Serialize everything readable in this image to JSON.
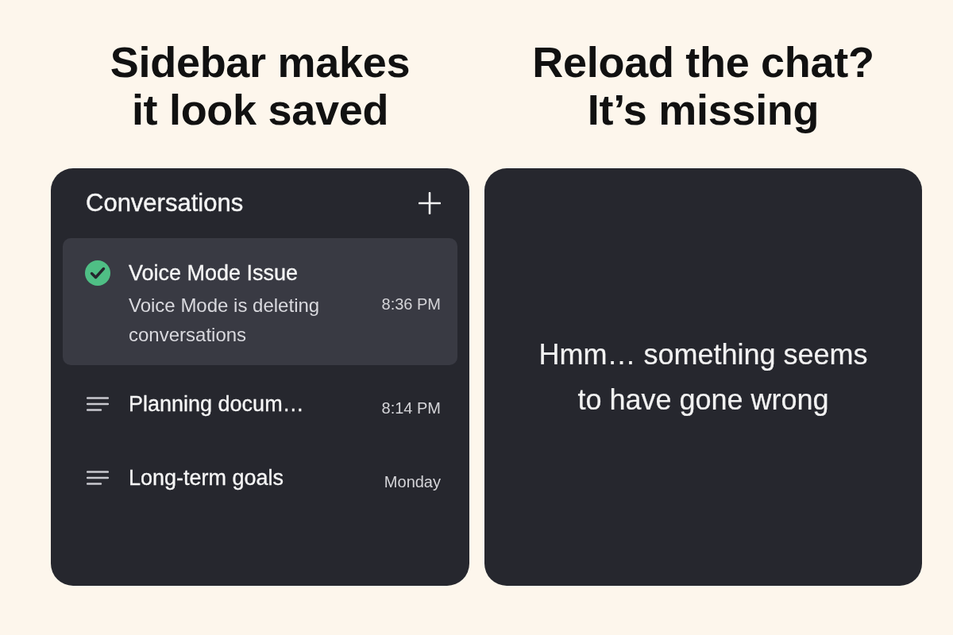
{
  "panels": [
    {
      "kind": "sidebar",
      "caption": "Sidebar makes\nit look saved",
      "header": {
        "title": "Conversations"
      },
      "conversations": [
        {
          "title": "Voice Mode Issue",
          "snippet": "Voice Mode is deleting conversations",
          "time": "8:36 PM",
          "selected": true,
          "checked": true
        },
        {
          "title": "Planning docum…",
          "time": "8:14 PM",
          "selected": false,
          "checked": false
        },
        {
          "title": "Long-term goals",
          "time": "Monday",
          "selected": false,
          "checked": false
        }
      ]
    },
    {
      "kind": "error",
      "caption": "Reload the chat?\nIt’s missing",
      "message": "Hmm… something seems to have gone wrong"
    }
  ]
}
